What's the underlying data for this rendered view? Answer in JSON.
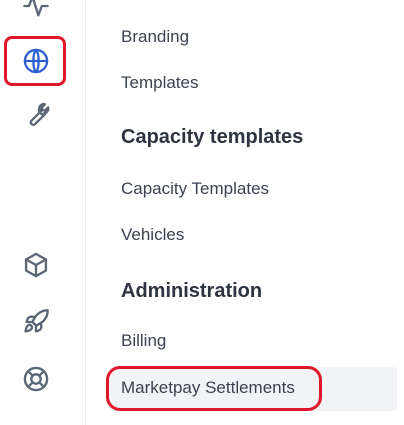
{
  "rail": {
    "icons": [
      {
        "name": "activity-icon"
      },
      {
        "name": "globe-icon"
      },
      {
        "name": "wrench-icon"
      },
      {
        "name": "cube-icon"
      },
      {
        "name": "rocket-icon"
      },
      {
        "name": "lifebuoy-icon"
      }
    ],
    "active_icon": "globe-icon",
    "active_color": "#2f5fd0"
  },
  "menu": {
    "items_group_1": [
      {
        "label": "Branding"
      },
      {
        "label": "Templates"
      }
    ],
    "capacity_heading": "Capacity templates",
    "items_group_2": [
      {
        "label": "Capacity Templates"
      },
      {
        "label": "Vehicles"
      }
    ],
    "administration_heading": "Administration",
    "items_group_3": [
      {
        "label": "Billing"
      },
      {
        "label": "Marketpay Settlements"
      }
    ],
    "selected_item": "Marketpay Settlements"
  },
  "annotation_color": "#e0162b"
}
